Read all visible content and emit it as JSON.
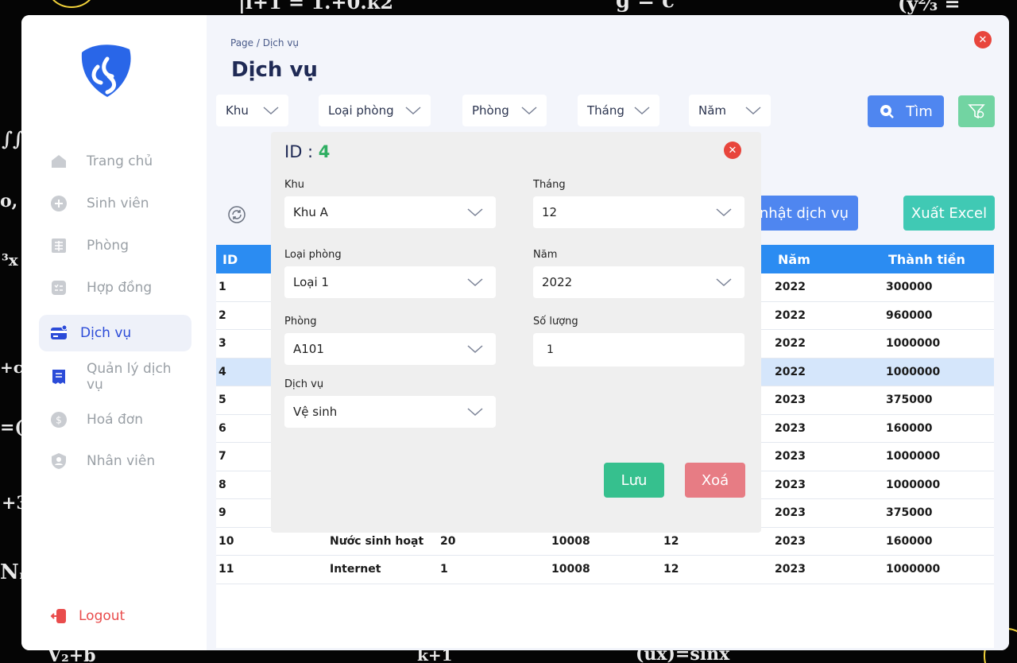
{
  "sidebar": {
    "items": [
      {
        "label": "Trang chủ",
        "icon": "home-icon"
      },
      {
        "label": "Sinh viên",
        "icon": "plus-circle-icon"
      },
      {
        "label": "Phòng",
        "icon": "building-icon"
      },
      {
        "label": "Hợp đồng",
        "icon": "contract-icon"
      },
      {
        "label": "Dịch vụ",
        "icon": "card-icon"
      },
      {
        "label": "Quản lý dịch vụ",
        "icon": "receipt-icon"
      },
      {
        "label": "Hoá đơn",
        "icon": "dollar-icon"
      },
      {
        "label": "Nhân viên",
        "icon": "user-shield-icon"
      }
    ],
    "active_index": 4,
    "logout_label": "Logout"
  },
  "header": {
    "breadcrumb": "Page / Dịch vụ",
    "title": "Dịch vụ"
  },
  "filters": {
    "khu": "Khu",
    "loai_phong": "Loại phòng",
    "phong": "Phòng",
    "thang": "Tháng",
    "nam": "Năm",
    "search_label": "Tìm"
  },
  "actions": {
    "update_label": "Cập nhật dịch vụ",
    "excel_label": "Xuất Excel"
  },
  "table": {
    "columns": [
      "ID",
      "",
      "",
      "",
      "",
      "Năm",
      "Thành tiền"
    ],
    "selected_id": "4",
    "rows": [
      {
        "id": "1",
        "service": "",
        "qty": "",
        "room": "",
        "month": "",
        "year": "2022",
        "total": "300000"
      },
      {
        "id": "2",
        "service": "",
        "qty": "",
        "room": "",
        "month": "",
        "year": "2022",
        "total": "960000"
      },
      {
        "id": "3",
        "service": "",
        "qty": "",
        "room": "",
        "month": "",
        "year": "2022",
        "total": "1000000"
      },
      {
        "id": "4",
        "service": "",
        "qty": "",
        "room": "",
        "month": "",
        "year": "2022",
        "total": "1000000"
      },
      {
        "id": "5",
        "service": "",
        "qty": "",
        "room": "",
        "month": "",
        "year": "2023",
        "total": "375000"
      },
      {
        "id": "6",
        "service": "",
        "qty": "",
        "room": "",
        "month": "",
        "year": "2023",
        "total": "160000"
      },
      {
        "id": "7",
        "service": "",
        "qty": "",
        "room": "",
        "month": "",
        "year": "2023",
        "total": "1000000"
      },
      {
        "id": "8",
        "service": "",
        "qty": "",
        "room": "",
        "month": "",
        "year": "2023",
        "total": "1000000"
      },
      {
        "id": "9",
        "service": "",
        "qty": "",
        "room": "",
        "month": "",
        "year": "2023",
        "total": "375000"
      },
      {
        "id": "10",
        "service": "Nước sinh hoạt",
        "qty": "20",
        "room": "10008",
        "month": "12",
        "year": "2023",
        "total": "160000"
      },
      {
        "id": "11",
        "service": "Internet",
        "qty": "1",
        "room": "10008",
        "month": "12",
        "year": "2023",
        "total": "1000000"
      }
    ]
  },
  "modal": {
    "id_label": "ID : ",
    "id_value": "4",
    "khu_label": "Khu",
    "khu_value": "Khu A",
    "loai_phong_label": "Loại phòng",
    "loai_phong_value": "Loại 1",
    "phong_label": "Phòng",
    "phong_value": "A101",
    "dich_vu_label": "Dịch vụ",
    "dich_vu_value": "Vệ sinh",
    "thang_label": "Tháng",
    "thang_value": "12",
    "nam_label": "Năm",
    "nam_value": "2022",
    "so_luong_label": "Số lượng",
    "so_luong_value": "1",
    "save_label": "Lưu",
    "delete_label": "Xoá"
  },
  "colors": {
    "accent_blue": "#4f86f0",
    "table_header": "#2b8cf2",
    "green": "#36c08e",
    "red": "#e8453c"
  }
}
